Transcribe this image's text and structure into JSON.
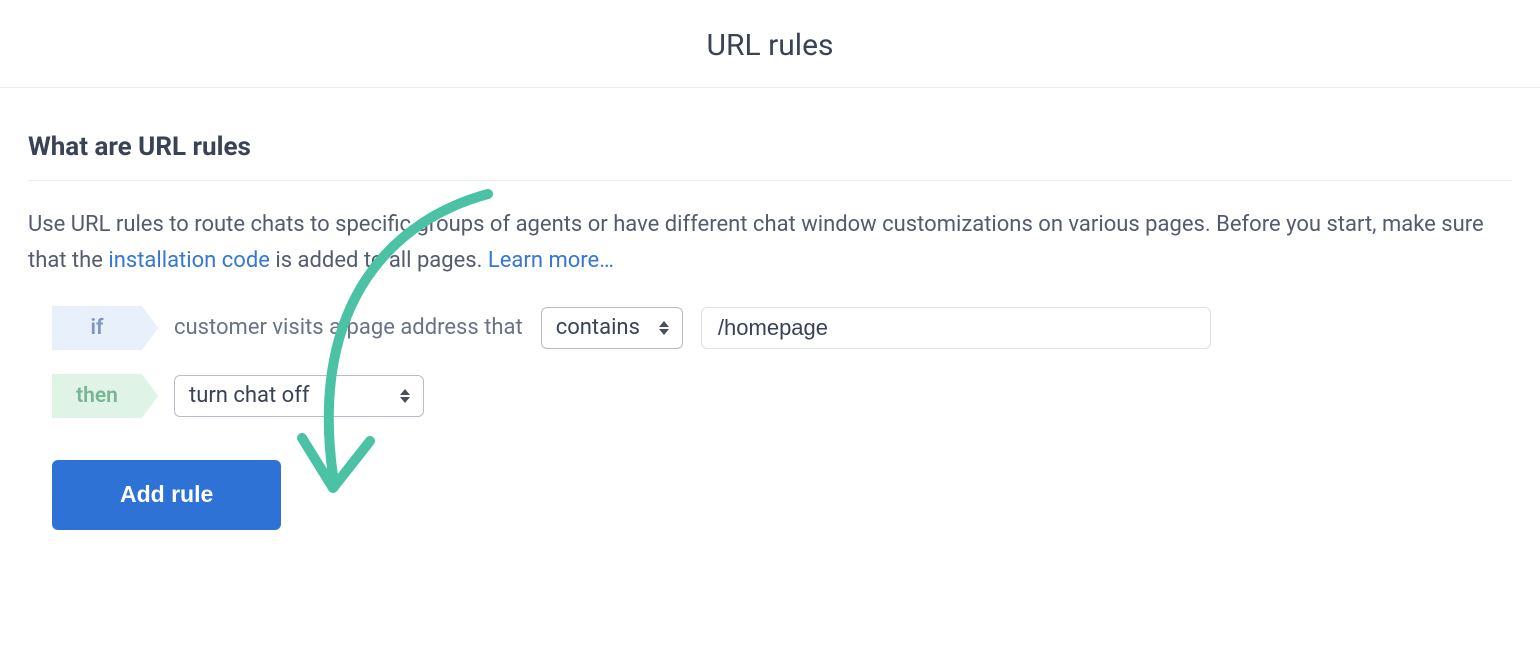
{
  "page": {
    "title": "URL rules"
  },
  "section": {
    "heading": "What are URL rules",
    "description_pre": "Use URL rules to route chats to specific groups of agents or have different chat window customizations on various pages. Before you start, make sure that the ",
    "link_installation": "installation code",
    "description_mid": " is added to all pages. ",
    "link_learn_more": "Learn more…"
  },
  "rule": {
    "if_label": "if",
    "then_label": "then",
    "condition_text": "customer visits a page address that",
    "match_operator": "contains",
    "url_value": "/homepage",
    "action": "turn chat off"
  },
  "buttons": {
    "add_rule": "Add rule"
  }
}
